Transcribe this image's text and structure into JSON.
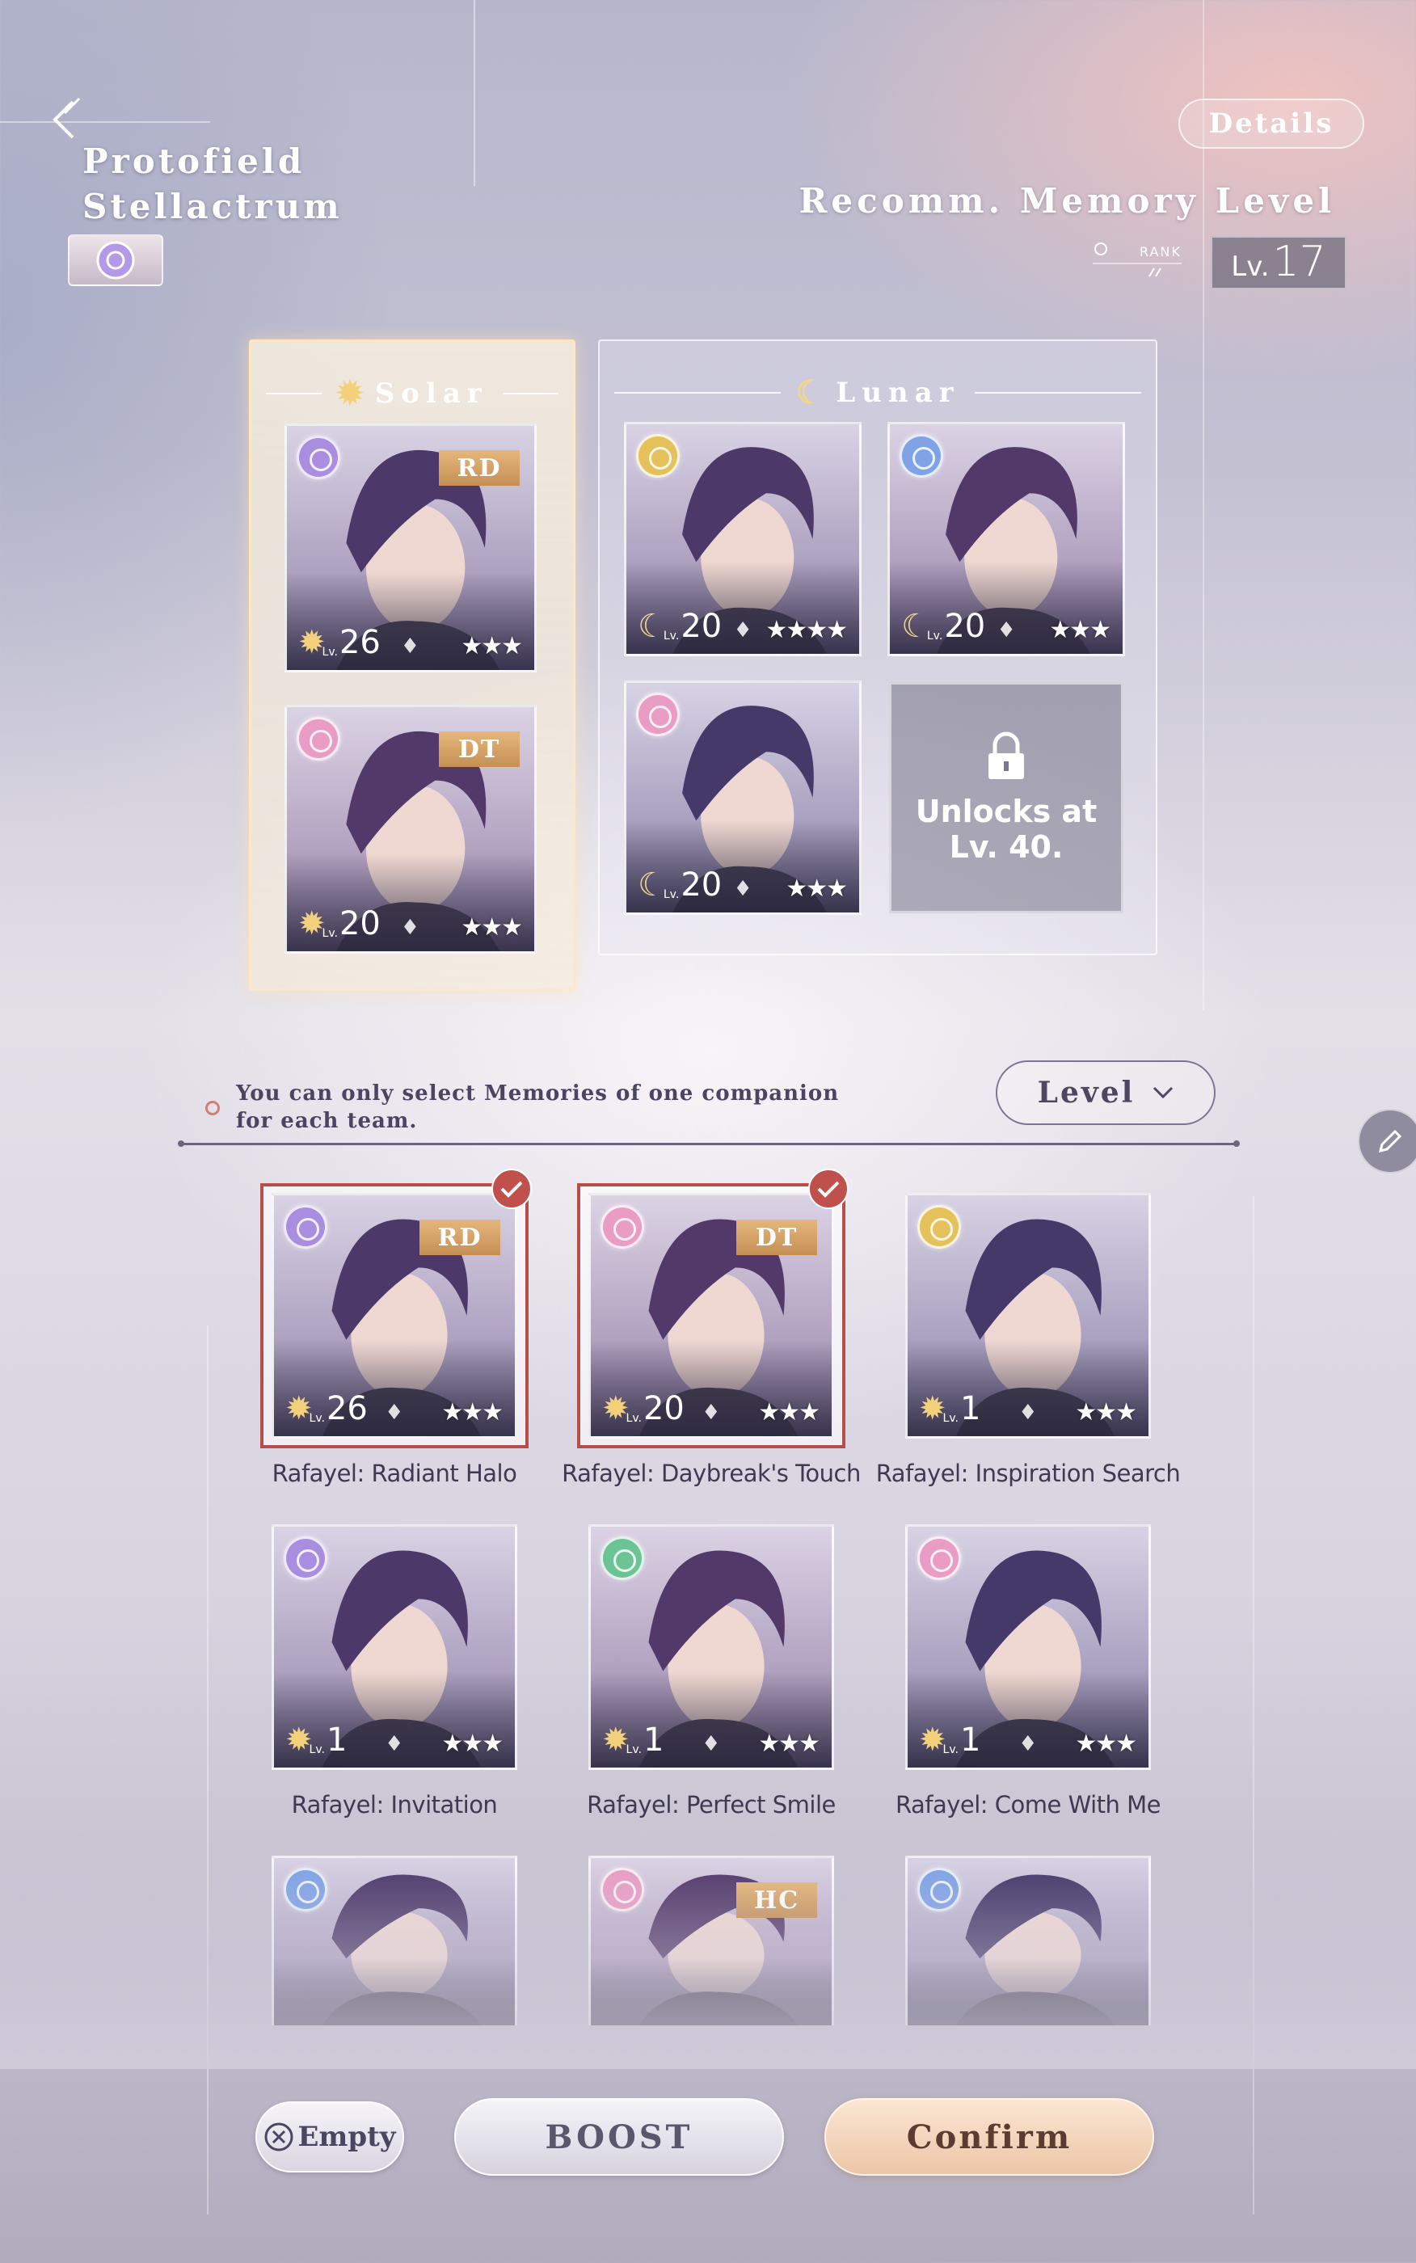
{
  "header": {
    "title_line1": "Protofield",
    "title_line2": "Stellactrum",
    "details_label": "Details",
    "recommended_label": "Recomm. Memory Level",
    "rank_label": "RANK",
    "level_prefix": "Lv.",
    "level_value": "17"
  },
  "teams": {
    "solar": {
      "label": "Solar",
      "cards": [
        {
          "tag": "RD",
          "level": "26",
          "stars": "★★★",
          "gem_color": "#a98ee0"
        },
        {
          "tag": "DT",
          "level": "20",
          "stars": "★★★",
          "gem_color": "#e99cc4"
        }
      ]
    },
    "lunar": {
      "label": "Lunar",
      "cards": [
        {
          "level": "20",
          "stars": "★★★★",
          "gem_color": "#e5c15c"
        },
        {
          "level": "20",
          "stars": "★★★",
          "gem_color": "#7fa3e6"
        },
        {
          "level": "20",
          "stars": "★★★",
          "gem_color": "#e99cc4"
        }
      ],
      "locked_text": "Unlocks at Lv. 40."
    }
  },
  "filter": {
    "notice": "You can only select Memories of one companion for each team.",
    "sort_label": "Level"
  },
  "memories": [
    {
      "name": "Rafayel: Radiant Halo",
      "tag": "RD",
      "level": "26",
      "stars": "★★★",
      "gem_color": "#a98ee0",
      "selected": true
    },
    {
      "name": "Rafayel: Daybreak's Touch",
      "tag": "DT",
      "level": "20",
      "stars": "★★★",
      "gem_color": "#e99cc4",
      "selected": true
    },
    {
      "name": "Rafayel: Inspiration Search",
      "level": "1",
      "stars": "★★★",
      "gem_color": "#e5c15c",
      "selected": false
    },
    {
      "name": "Rafayel: Invitation",
      "level": "1",
      "stars": "★★★",
      "gem_color": "#a98ee0",
      "selected": false
    },
    {
      "name": "Rafayel: Perfect Smile",
      "level": "1",
      "stars": "★★★",
      "gem_color": "#6cc495",
      "selected": false
    },
    {
      "name": "Rafayel: Come With Me",
      "level": "1",
      "stars": "★★★",
      "gem_color": "#e99cc4",
      "selected": false
    },
    {
      "gem_color": "#7fa3e6"
    },
    {
      "tag": "HC",
      "gem_color": "#e99cc4"
    },
    {
      "gem_color": "#7fa3e6"
    }
  ],
  "actions": {
    "empty_label": "Empty",
    "boost_label": "BOOST",
    "confirm_label": "Confirm"
  },
  "icons": {
    "sun": "sun-icon",
    "moon": "moon-icon",
    "lock": "lock-icon",
    "check": "check-icon",
    "edit": "pencil-icon",
    "back": "back-arrow-icon"
  },
  "colors": {
    "selected_border": "#b64f4a",
    "confirm_bg": "#ecc6a6",
    "tag_gold": "#d39e63"
  }
}
